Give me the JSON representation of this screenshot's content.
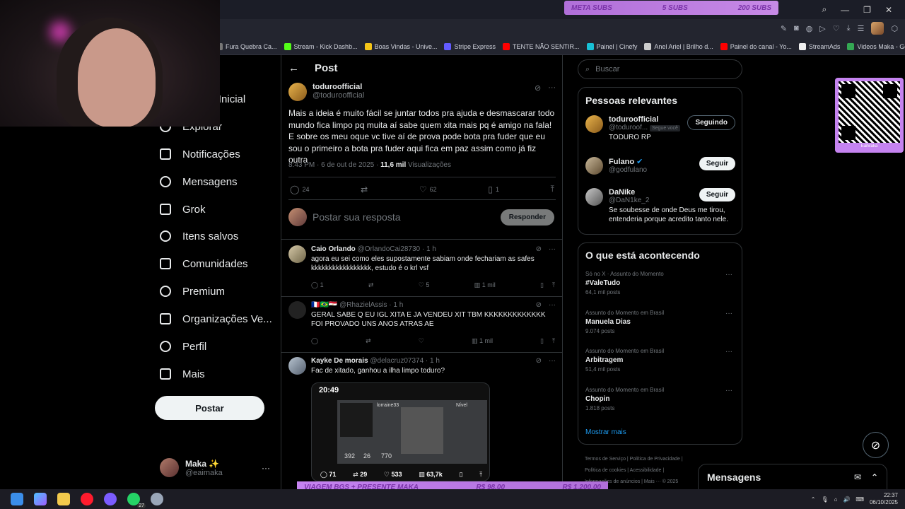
{
  "overlay": {
    "subs": {
      "label": "META SUBS",
      "current": "5 SUBS",
      "goal": "200 SUBS"
    },
    "goal_bar": {
      "label": "VIAGEM BGS + PRESENTE MAKA",
      "current": "R$ 98,00",
      "goal": "R$ 1.200,00"
    },
    "qr_label": "EaiMaka"
  },
  "bookmarks": [
    {
      "label": "Fura Quebra Ca...",
      "color": "#777"
    },
    {
      "label": "Stream - Kick Dashb...",
      "color": "#53fc18"
    },
    {
      "label": "Boas Vindas - Unive...",
      "color": "#f5c518"
    },
    {
      "label": "Stripe Express",
      "color": "#635bff"
    },
    {
      "label": "TENTE NÃO SENTIR...",
      "color": "#ff0000"
    },
    {
      "label": "Painel | Cinefy",
      "color": "#18c1d6"
    },
    {
      "label": "Anel Ariel | Brilho d...",
      "color": "#cccccc"
    },
    {
      "label": "Painel do canal - Yo...",
      "color": "#ff0000"
    },
    {
      "label": "StreamAds",
      "color": "#eeeeee"
    },
    {
      "label": "Videos Maka - Goo...",
      "color": "#34a853"
    }
  ],
  "nav": {
    "items": [
      {
        "label": "Página Inicial",
        "icon": "home-icon"
      },
      {
        "label": "Explorar",
        "icon": "search-icon"
      },
      {
        "label": "Notificações",
        "icon": "bell-icon"
      },
      {
        "label": "Mensagens",
        "icon": "mail-icon"
      },
      {
        "label": "Grok",
        "icon": "grok-icon"
      },
      {
        "label": "Itens salvos",
        "icon": "bookmark-icon"
      },
      {
        "label": "Comunidades",
        "icon": "people-icon"
      },
      {
        "label": "Premium",
        "icon": "x-logo-icon"
      },
      {
        "label": "Organizações Ve...",
        "icon": "lightning-icon"
      },
      {
        "label": "Perfil",
        "icon": "person-icon"
      },
      {
        "label": "Mais",
        "icon": "more-circle-icon"
      }
    ],
    "post_button": "Postar",
    "account": {
      "name": "Maka ✨",
      "handle": "@eaimaka"
    }
  },
  "post": {
    "header": "Post",
    "author": {
      "name": "toduroofficial",
      "handle": "@toduroofficial"
    },
    "text": "Mais a ideia é muito fácil se juntar todos pra ajuda e desmascarar todo mundo fica limpo pq muita aí sabe quem xita mais pq é amigo na fala! E sobre os meu oque vc tive aí de prova pode bota pra fuder que eu sou o primeiro a bota pra fuder aqui fica em paz assim como já fiz outra",
    "timestamp": "8:43 PM · 6 de out de 2025 · ",
    "views": "11,6 mil",
    "views_label": " Visualizações",
    "stats": {
      "replies": "24",
      "reposts": "",
      "likes": "62",
      "bookmarks": "1"
    },
    "reply_placeholder": "Postar sua resposta",
    "reply_button": "Responder"
  },
  "replies": [
    {
      "name": "Caio Orlando",
      "handle": "@OrlandoCai28730 · 1 h",
      "text": "agora eu sei como eles supostamente sabiam onde fechariam as safes kkkkkkkkkkkkkkkkk, estudo é o krl vsf",
      "replies": "1",
      "reposts": "",
      "likes": "5",
      "views": "1 mil"
    },
    {
      "name": "🇫🇷🇧🇷🇪🇬",
      "handle": "@RhazielAssis · 1 h",
      "text": "GERAL SABE Q EU IGL XITA E JA VENDEU XIT TBM KKKKKKKKKKKKK FOI PROVADO UNS ANOS ATRAS AE",
      "replies": "",
      "reposts": "",
      "likes": "",
      "views": "1 mil"
    },
    {
      "name": "Kayke De morais",
      "handle": "@delacruz07374 · 1 h",
      "text": "Fac de xitado, ganhou a ilha limpo toduro?",
      "image": {
        "time": "20:49",
        "nick": "lorraine33",
        "level": "Nível",
        "stat1": "392",
        "stat2": "26",
        "stat3": "770",
        "r": "71",
        "rt": "29",
        "l": "533",
        "v": "63,7k"
      }
    }
  ],
  "right": {
    "search_placeholder": "Buscar",
    "relevant_title": "Pessoas relevantes",
    "people": [
      {
        "name": "toduroofficial",
        "handle": "@toduroof...",
        "badge": "Segue você",
        "bio": "TODURO RP",
        "button": "Seguindo"
      },
      {
        "name": "Fulano",
        "handle": "@godfulano",
        "bio": "",
        "button": "Seguir"
      },
      {
        "name": "DaNike",
        "handle": "@DaN1ke_2",
        "bio": "Se soubesse de onde Deus me tirou, entenderia porque acredito tanto nele.",
        "button": "Seguir"
      }
    ],
    "trends_title": "O que está acontecendo",
    "trends": [
      {
        "context": "Só no X · Assunto do Momento",
        "topic": "#ValeTudo",
        "posts": "64,1 mil posts"
      },
      {
        "context": "Assunto do Momento em Brasil",
        "topic": "Manuela Dias",
        "posts": "9.074 posts"
      },
      {
        "context": "Assunto do Momento em Brasil",
        "topic": "Arbitragem",
        "posts": "51,4 mil posts"
      },
      {
        "context": "Assunto do Momento em Brasil",
        "topic": "Chopin",
        "posts": "1.818 posts"
      }
    ],
    "show_more": "Mostrar mais",
    "footer": {
      "l1": "Termos de Serviço  |  Política de Privacidade  |",
      "l2": "Política de cookies  |  Acessibilidade  |",
      "l3": "Informações de anúncios  |  Mais ···  © 2025"
    }
  },
  "messages_bar": "Mensagens",
  "taskbar": {
    "time": "22:37",
    "date": "06/10/2025",
    "badge": "27"
  }
}
